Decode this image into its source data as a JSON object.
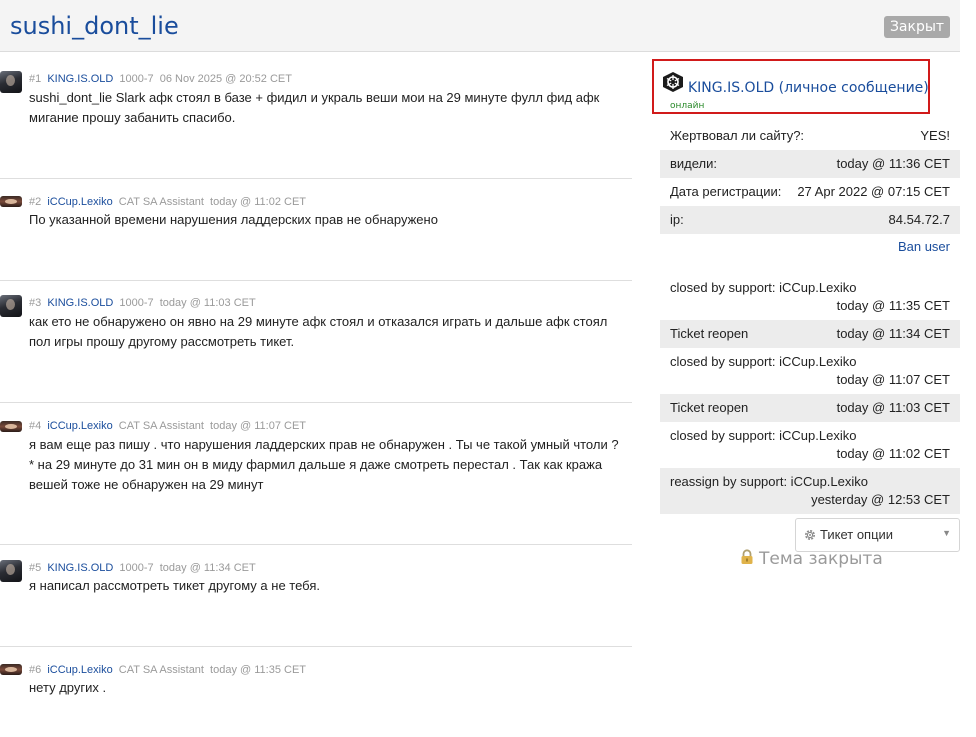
{
  "header": {
    "title": "sushi_dont_lie",
    "status": "Закрыт"
  },
  "posts": [
    {
      "num": "#1",
      "author": "KING.IS.OLD",
      "rank": "1000-7",
      "date": "06 Nov 2025 @ 20:52 CET",
      "lines": [
        "sushi_dont_lie Slark афк стоял в базе + фидил и украль веши мои на 29 минуте фулл фид афк",
        "мигание прошу забанить спасибо."
      ]
    },
    {
      "num": "#2",
      "author": "iCCup.Lexiko",
      "rank": "CAT SA Assistant",
      "date": "today @ 11:02 CET",
      "lines": [
        "По указанной времени нарушения ладдерских прав не обнаружено"
      ]
    },
    {
      "num": "#3",
      "author": "KING.IS.OLD",
      "rank": "1000-7",
      "date": "today @ 11:03 CET",
      "lines": [
        "как ето не обнаружено он явно на 29 минуте афк стоял и отказался играть и дальше афк стоял",
        "пол игры прошу другому рассмотреть тикет."
      ]
    },
    {
      "num": "#4",
      "author": "iCCup.Lexiko",
      "rank": "CAT SA Assistant",
      "date": "today @ 11:07 CET",
      "lines": [
        "я вам еще раз пишу . что нарушения ладдерских прав не обнаружен . Ты че такой умный чтоли ?",
        "* на 29 минуте до 31 мин он в миду фармил дальше я даже смотреть перестал . Так как кража",
        "вешей тоже не обнаружен на 29 минут"
      ]
    },
    {
      "num": "#5",
      "author": "KING.IS.OLD",
      "rank": "1000-7",
      "date": "today @ 11:34 CET",
      "lines": [
        "я написал рассмотреть тикет другому а не тебя."
      ]
    },
    {
      "num": "#6",
      "author": "iCCup.Lexiko",
      "rank": "CAT SA Assistant",
      "date": "today @ 11:35 CET",
      "lines": [
        "нету других ."
      ]
    }
  ],
  "sidebar": {
    "user": {
      "name": "KING.IS.OLD",
      "pm_label": "(личное сообщение)",
      "status": "онлайн"
    },
    "info": [
      {
        "label": "Жертвовал ли сайту?:",
        "value": "YES!"
      },
      {
        "label": "видели:",
        "value": "today @ 11:36 CET"
      },
      {
        "label": "Дата регистрации:",
        "value": "27 Apr 2022 @ 07:15 CET"
      },
      {
        "label": "ip:",
        "value": "84.54.72.7"
      }
    ],
    "ban_label": "Ban user",
    "log": [
      {
        "action": "closed by support: iCCup.Lexiko",
        "time": "today @ 11:35 CET"
      },
      {
        "action": "Ticket reopen",
        "time": "today @ 11:34 CET"
      },
      {
        "action": "closed by support: iCCup.Lexiko",
        "time": "today @ 11:07 CET"
      },
      {
        "action": "Ticket reopen",
        "time": "today @ 11:03 CET"
      },
      {
        "action": "closed by support: iCCup.Lexiko",
        "time": "today @ 11:02 CET"
      },
      {
        "action": "reassign by support: iCCup.Lexiko",
        "time": "yesterday @ 12:53 CET"
      }
    ],
    "ticket_options_label": "Тикет опции",
    "topic_closed_label": "Тема закрыта"
  },
  "icons": {
    "user_logo": "iccup-logo-icon",
    "gear": "gear-icon",
    "lock": "lock-icon",
    "caret": "chevron-down-icon"
  },
  "colors": {
    "link": "#1a4d9c",
    "highlight_border": "#d11a1a",
    "online": "#2a8a2a",
    "badge": "#a9a9a9"
  }
}
